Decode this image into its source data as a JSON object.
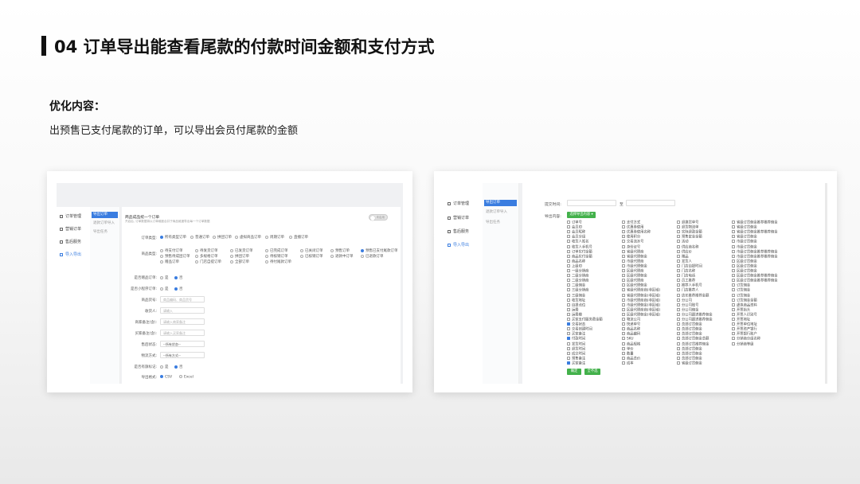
{
  "slide": {
    "title": "04 订单导出能查看尾款的付款时间金额和支付方式",
    "section_heading": "优化内容：",
    "description": "出预售已支付尾款的订单，可以导出会员付尾款的金额"
  },
  "shot1": {
    "sidebar": [
      "订单管理",
      "营销订单",
      "售后服务",
      "导入导出"
    ],
    "subnav": [
      "导出订单",
      "退款订单导入",
      "导出任务"
    ],
    "header_title": "商品成品统一个订单",
    "header_note": "开启后, 订单数据将以订单维度合并于商品维度导出每一个订单数据",
    "toggle_text": "未启用",
    "rows": {
      "order_type": {
        "label": "订单类型:",
        "options": [
          "所有类型订单",
          "普通订单",
          "拼团订单",
          "虚拟商品订单",
          "周期订单",
          "直播订单"
        ]
      },
      "order_status": {
        "label": "商品类型:",
        "options": [
          "待支付订单",
          "待发货订单",
          "已发货订单",
          "已完成订单",
          "已关闭订单",
          "预售订单",
          "待付尾款订单",
          "预售已支付尾款订单",
          "预售待成团订单",
          "多规格订单",
          "拼团订单",
          "待核销订单",
          "已核销订单",
          "退款中订单",
          "已退款订单",
          "赠品订单",
          "门店自提订单",
          "全部订单"
        ]
      },
      "is_gift": {
        "label": "是否赠品订单:",
        "options": [
          "是",
          "否"
        ]
      },
      "is_mini": {
        "label": "是否小程序订单:",
        "options": [
          "是",
          "否"
        ]
      },
      "product_no": {
        "label": "商品货号:",
        "placeholder": "商品编码、商品货号"
      },
      "buyer": {
        "label": "收货人:",
        "placeholder": "请输入"
      },
      "remark_seller": {
        "label": "商家备注(含):",
        "placeholder": "请输入商家备注"
      },
      "remark_buyer": {
        "label": "买家备注(含):",
        "placeholder": "请输入买家备注"
      },
      "refund_status": {
        "label": "售后状态:",
        "value": "--所有状态--"
      },
      "logistics": {
        "label": "物流方式:",
        "value": "--所有方式--"
      },
      "is_flag": {
        "label": "是否有旗标记:",
        "options": [
          "是",
          "否"
        ]
      },
      "export_format": {
        "label": "导出格式:",
        "options": [
          "CSV",
          "Excel"
        ]
      }
    }
  },
  "shot2": {
    "sidebar": [
      "订单管理",
      "营销订单",
      "售后服务",
      "导入导出"
    ],
    "subnav": [
      "导出订单",
      "退款订单导入",
      "导出任务"
    ],
    "time_label": "提交时间:",
    "time_sep": "至",
    "content_label": "导出内容:",
    "select_button": "选择导出内容",
    "fields": [
      "订单号",
      "会员ID",
      "会员昵称",
      "会员分组",
      "收货人姓名",
      "收货人手机号",
      "订单实付金额",
      "商品实付金额",
      "商品名称",
      "上级ID",
      "一级分销商",
      "二级分销商",
      "二级分销商",
      "二级佣金",
      "三级分销商",
      "三级佣金",
      "收货地址",
      "自提点位",
      "运费",
      "运费模",
      "买家支付服务费金额",
      "交易状态",
      "交易创建时间",
      "买家备注",
      "付款时间",
      "发货时间",
      "退货时间",
      "成交时间",
      "预售备注",
      "买家备注",
      "支付方式",
      "优惠券使用",
      "优惠券使用名称",
      "使用积分",
      "交易流水号",
      "身份证号",
      "省级代理商",
      "省级代理佣金",
      "市级代理商",
      "市级代理佣金",
      "区级代理商",
      "区级代理佣金",
      "区级代理商",
      "区级代理佣金",
      "省级代理商商(非区域)",
      "省级代理佣金(非区域)",
      "市级代理商商(非区域)",
      "市级代理佣金(非区域)",
      "区级代理商商(非区域)",
      "区级代理佣金(非区域)",
      "物流公司",
      "快递单号",
      "商品名称",
      "商品编码",
      "SKU",
      "商品规格",
      "单价",
      "数量",
      "商品总价",
      "成本",
      "退换货单号",
      "退货物流单",
      "实际退款金额",
      "预售定金金额",
      "活动",
      "供应商名称",
      "供应价",
      "赠品",
      "发货人",
      "门店自提时间",
      "门店名称",
      "门店电话",
      "员工推荐",
      "推荐人手机号",
      "门店推荐人",
      "店长推荐推荐金额",
      "分公司",
      "分公司账号",
      "分公司佣金",
      "分公司跟进推荐佣金",
      "分公司跟进推荐佣金",
      "总部订货佣金",
      "总部订货佣金",
      "总部订货佣金",
      "总部订货佣金总额",
      "总部订货推荐佣金",
      "总部订货佣金",
      "总部订货佣金",
      "总部订货佣金",
      "省级订货佣金",
      "省级订货佣金推荐推荐佣金",
      "省级订货佣金",
      "省级订货佣金推荐推荐佣金",
      "省级订货佣金",
      "市级订货佣金",
      "市级订货佣金",
      "市级订货佣金推荐推荐佣金",
      "市级订货佣金推荐推荐佣金",
      "区级订货佣金",
      "区级订货佣金",
      "区级订货佣金",
      "区级订货佣金推荐推荐佣金",
      "区级订货佣金推荐推荐佣金",
      "订货佣金",
      "订货佣金",
      "订货佣金",
      "订货佣金金额",
      "虚拟商品资料",
      "开票抬头",
      "开票人识别号",
      "开票地址",
      "开票单位地址",
      "开票资产银行",
      "开票银行账户",
      "分销商分组名称",
      "分销商等级"
    ],
    "checked_fields": [
      21,
      24,
      29
    ],
    "buttons": {
      "confirm": "确定",
      "select_all": "全不选"
    }
  }
}
